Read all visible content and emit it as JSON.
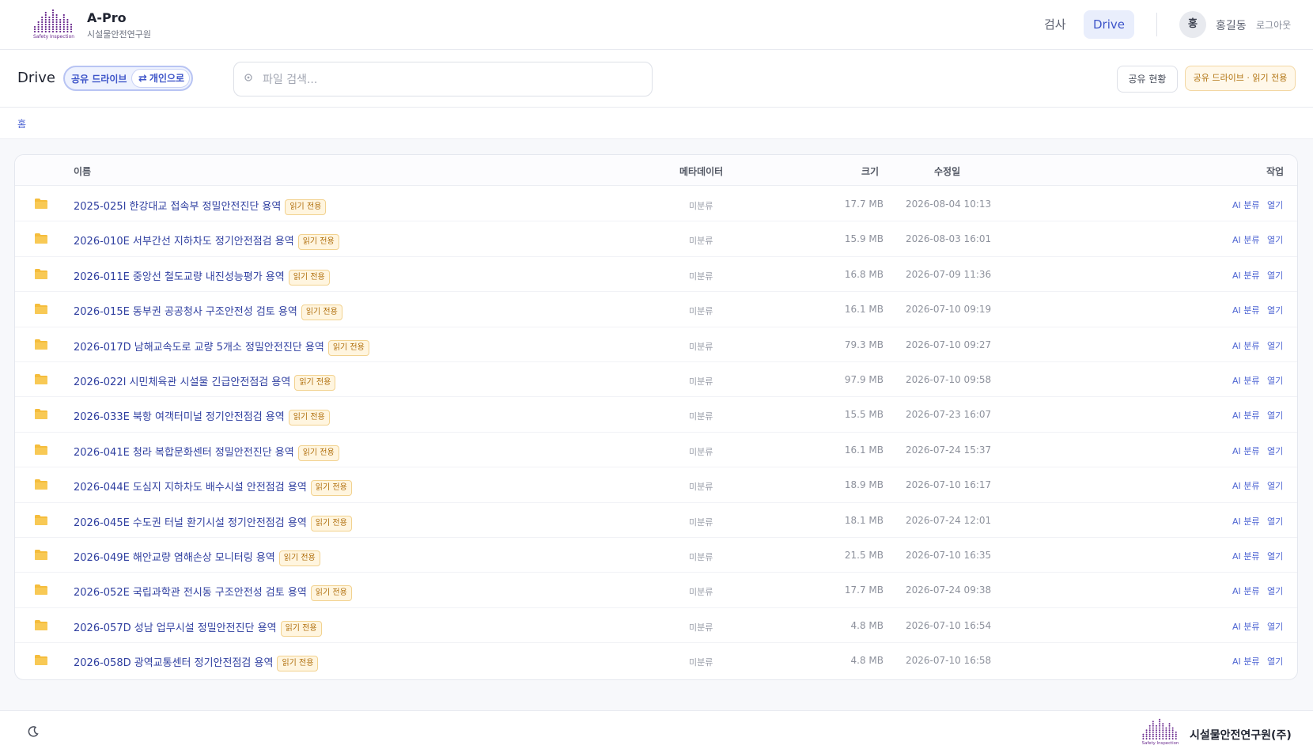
{
  "header": {
    "app_name": "A-Pro",
    "org_subtitle": "시설물안전연구원",
    "logo_caption": "Safety Inspection",
    "nav_inspect": "검사",
    "nav_drive": "Drive",
    "avatar_initial": "홍",
    "user_name": "홍길동",
    "logout": "로그아웃"
  },
  "toolbar": {
    "title": "Drive",
    "shared_drive_label": "공유 드라이브",
    "switch_personal_label": "개인으로",
    "search_placeholder": "파일 검색...",
    "share_status_button": "공유 현황",
    "readonly_chip": "공유 드라이브 · 읽기 전용"
  },
  "breadcrumb": {
    "home": "홈"
  },
  "table": {
    "columns": {
      "name": "이름",
      "metadata": "메타데이터",
      "size": "크기",
      "modified": "수정일",
      "actions": "작업"
    },
    "badge_label": "읽기 전용",
    "meta_value": "미분류",
    "ai_action": "AI 분류",
    "open_action": "열기",
    "rows": [
      {
        "name": "2025-025I 한강대교 접속부 정밀안전진단 용역",
        "size": "17.7 MB",
        "modified": "2026-08-04 10:13"
      },
      {
        "name": "2026-010E 서부간선 지하차도 정기안전점검 용역",
        "size": "15.9 MB",
        "modified": "2026-08-03 16:01"
      },
      {
        "name": "2026-011E 중앙선 철도교량 내진성능평가 용역",
        "size": "16.8 MB",
        "modified": "2026-07-09 11:36"
      },
      {
        "name": "2026-015E 동부권 공공청사 구조안전성 검토 용역",
        "size": "16.1 MB",
        "modified": "2026-07-10 09:19"
      },
      {
        "name": "2026-017D 남해교속도로 교량 5개소 정밀안전진단 용역",
        "size": "79.3 MB",
        "modified": "2026-07-10 09:27"
      },
      {
        "name": "2026-022I 시민체육관 시설물 긴급안전점검 용역",
        "size": "97.9 MB",
        "modified": "2026-07-10 09:58"
      },
      {
        "name": "2026-033E 북항 여객터미널 정기안전점검 용역",
        "size": "15.5 MB",
        "modified": "2026-07-23 16:07"
      },
      {
        "name": "2026-041E 청라 복합문화센터 정밀안전진단 용역",
        "size": "16.1 MB",
        "modified": "2026-07-24 15:37"
      },
      {
        "name": "2026-044E 도심지 지하차도 배수시설 안전점검 용역",
        "size": "18.9 MB",
        "modified": "2026-07-10 16:17"
      },
      {
        "name": "2026-045E 수도권 터널 환기시설 정기안전점검 용역",
        "size": "18.1 MB",
        "modified": "2026-07-24 12:01"
      },
      {
        "name": "2026-049E 해안교량 염해손상 모니터링 용역",
        "size": "21.5 MB",
        "modified": "2026-07-10 16:35"
      },
      {
        "name": "2026-052E 국립과학관 전시동 구조안전성 검토 용역",
        "size": "17.7 MB",
        "modified": "2026-07-24 09:38"
      },
      {
        "name": "2026-057D 성남 업무시설 정밀안전진단 용역",
        "size": "4.8 MB",
        "modified": "2026-07-10 16:54"
      },
      {
        "name": "2026-058D 광역교통센터 정기안전점검 용역",
        "size": "4.8 MB",
        "modified": "2026-07-10 16:58"
      }
    ]
  },
  "footer": {
    "company": "시설물안전연구원(주)"
  },
  "colors": {
    "accent": "#3e55c9",
    "link": "#2f3fa0",
    "badge_text": "#b06f0d",
    "badge_bg": "#fff5df",
    "folder": "#f5bd3c",
    "logo_purple": "#6a2a8e"
  },
  "icons": {
    "folder": "folder-icon",
    "search": "search-icon",
    "swap": "swap-icon",
    "theme": "moon-icon",
    "logo": "logo-bars-icon"
  }
}
